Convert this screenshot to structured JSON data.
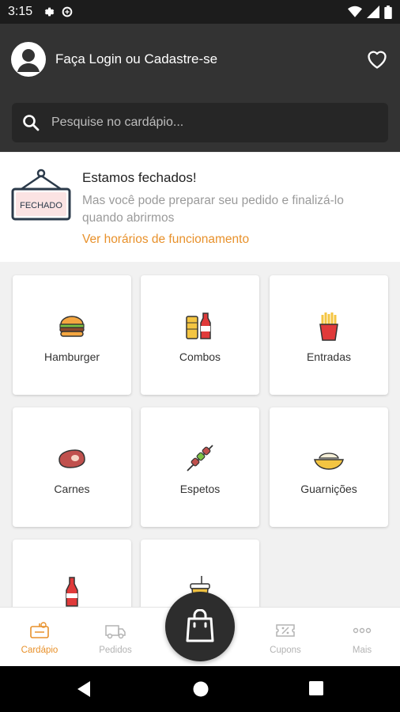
{
  "status_bar": {
    "time": "3:15"
  },
  "header": {
    "login_text": "Faça Login ou Cadastre-se",
    "search_placeholder": "Pesquise no cardápio..."
  },
  "closed_notice": {
    "sign_text": "FECHADO",
    "title": "Estamos fechados!",
    "subtitle": "Mas você pode preparar seu pedido e finalizá-lo quando abrirmos",
    "link": "Ver horários de funcionamento"
  },
  "categories": [
    {
      "label": "Hamburger",
      "icon": "burger-icon"
    },
    {
      "label": "Combos",
      "icon": "combo-icon"
    },
    {
      "label": "Entradas",
      "icon": "fries-icon"
    },
    {
      "label": "Carnes",
      "icon": "steak-icon"
    },
    {
      "label": "Espetos",
      "icon": "skewer-icon"
    },
    {
      "label": "Guarnições",
      "icon": "side-dish-icon"
    },
    {
      "label": "",
      "icon": "soda-bottle-icon"
    },
    {
      "label": "",
      "icon": "drink-cup-icon"
    }
  ],
  "bottom_nav": {
    "items": [
      {
        "label": "Cardápio",
        "icon": "menu-icon",
        "active": true
      },
      {
        "label": "Pedidos",
        "icon": "delivery-truck-icon",
        "active": false
      },
      {
        "label": "Cupons",
        "icon": "coupon-icon",
        "active": false
      },
      {
        "label": "Mais",
        "icon": "more-icon",
        "active": false
      }
    ],
    "fab_icon": "shopping-bag-icon"
  },
  "colors": {
    "header_bg": "#333333",
    "accent": "#e8912b",
    "inactive": "#b3b3b3"
  }
}
